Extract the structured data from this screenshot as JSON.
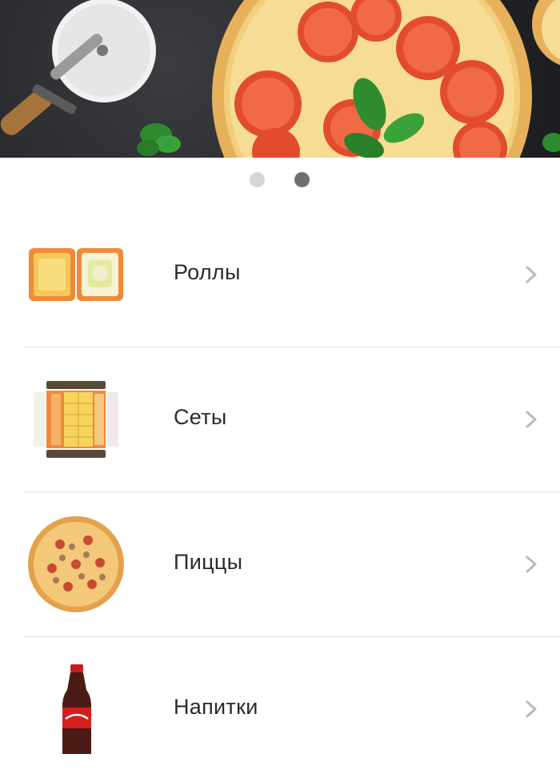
{
  "banner": {
    "slides_total": 2,
    "active_slide": 2
  },
  "categories": [
    {
      "label": "Роллы",
      "icon": "rolls-image"
    },
    {
      "label": "Сеты",
      "icon": "sushi-set-image"
    },
    {
      "label": "Пиццы",
      "icon": "pizza-image"
    },
    {
      "label": "Напитки",
      "icon": "drinks-image"
    }
  ],
  "colors": {
    "text": "#2b2b2b",
    "chevron": "#b9b9b9",
    "separator": "#e2e2e2",
    "dot_active": "#6f6f6f",
    "dot_inactive": "#d6d6d6"
  }
}
